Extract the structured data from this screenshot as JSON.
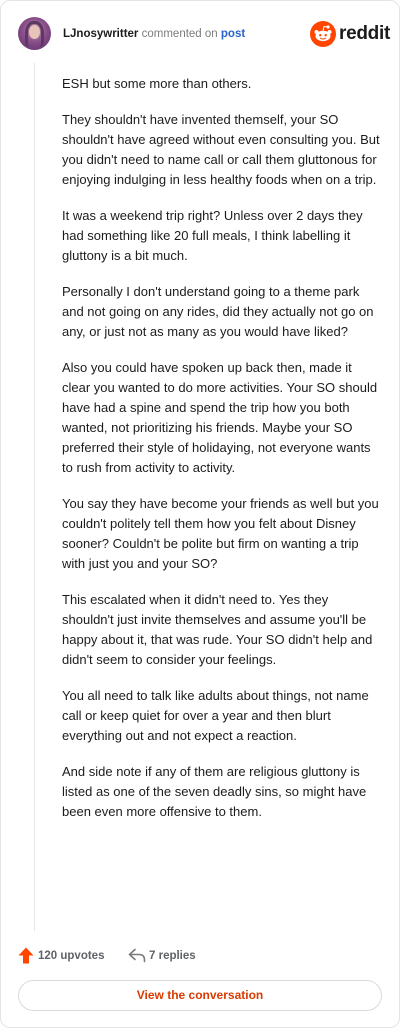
{
  "header": {
    "username": "LJnosywritter",
    "action_text": "commented on",
    "post_link": "post",
    "brand": "reddit"
  },
  "comment": {
    "paragraphs": [
      "ESH but some more than others.",
      "They shouldn't have invented themself, your SO shouldn't have agreed without even consulting you. But you didn't need to name call or call them gluttonous for enjoying indulging in less healthy foods when on a trip.",
      "It was a weekend trip right? Unless over 2 days they had something like 20 full meals, I think labelling it gluttony is a bit much.",
      "Personally I don't understand going to a theme park and not going on any rides, did they actually not go on any, or just not as many as you would have liked?",
      "Also you could have spoken up back then, made it clear you wanted to do more activities. Your SO should have had a spine and spend the trip how you both wanted, not prioritizing his friends. Maybe your SO preferred their style of holidaying, not everyone wants to rush from activity to activity.",
      "You say they have become your friends as well but you couldn't politely tell them how you felt about Disney sooner? Couldn't be polite but firm on wanting a trip with just you and your SO?",
      "This escalated when it didn't need to. Yes they shouldn't just invite themselves and assume you'll be happy about it, that was rude. Your SO didn't help and didn't seem to consider your feelings.",
      "You all need to talk like adults about things, not name call or keep quiet for over a year and then blurt everything out and not expect a reaction.",
      "And side note if any of them are religious gluttony is listed as one of the seven deadly sins, so might have been even more offensive to them."
    ]
  },
  "footer": {
    "upvotes": "120 upvotes",
    "replies": "7 replies",
    "cta_label": "View the conversation"
  },
  "colors": {
    "accent": "#d93a00",
    "upvote_arrow": "#ff4500",
    "link": "#2a63c9"
  },
  "icons": {
    "avatar": "user-avatar",
    "brand": "reddit-logo-icon",
    "upvote": "upvote-arrow-icon",
    "reply": "reply-arrow-icon"
  }
}
